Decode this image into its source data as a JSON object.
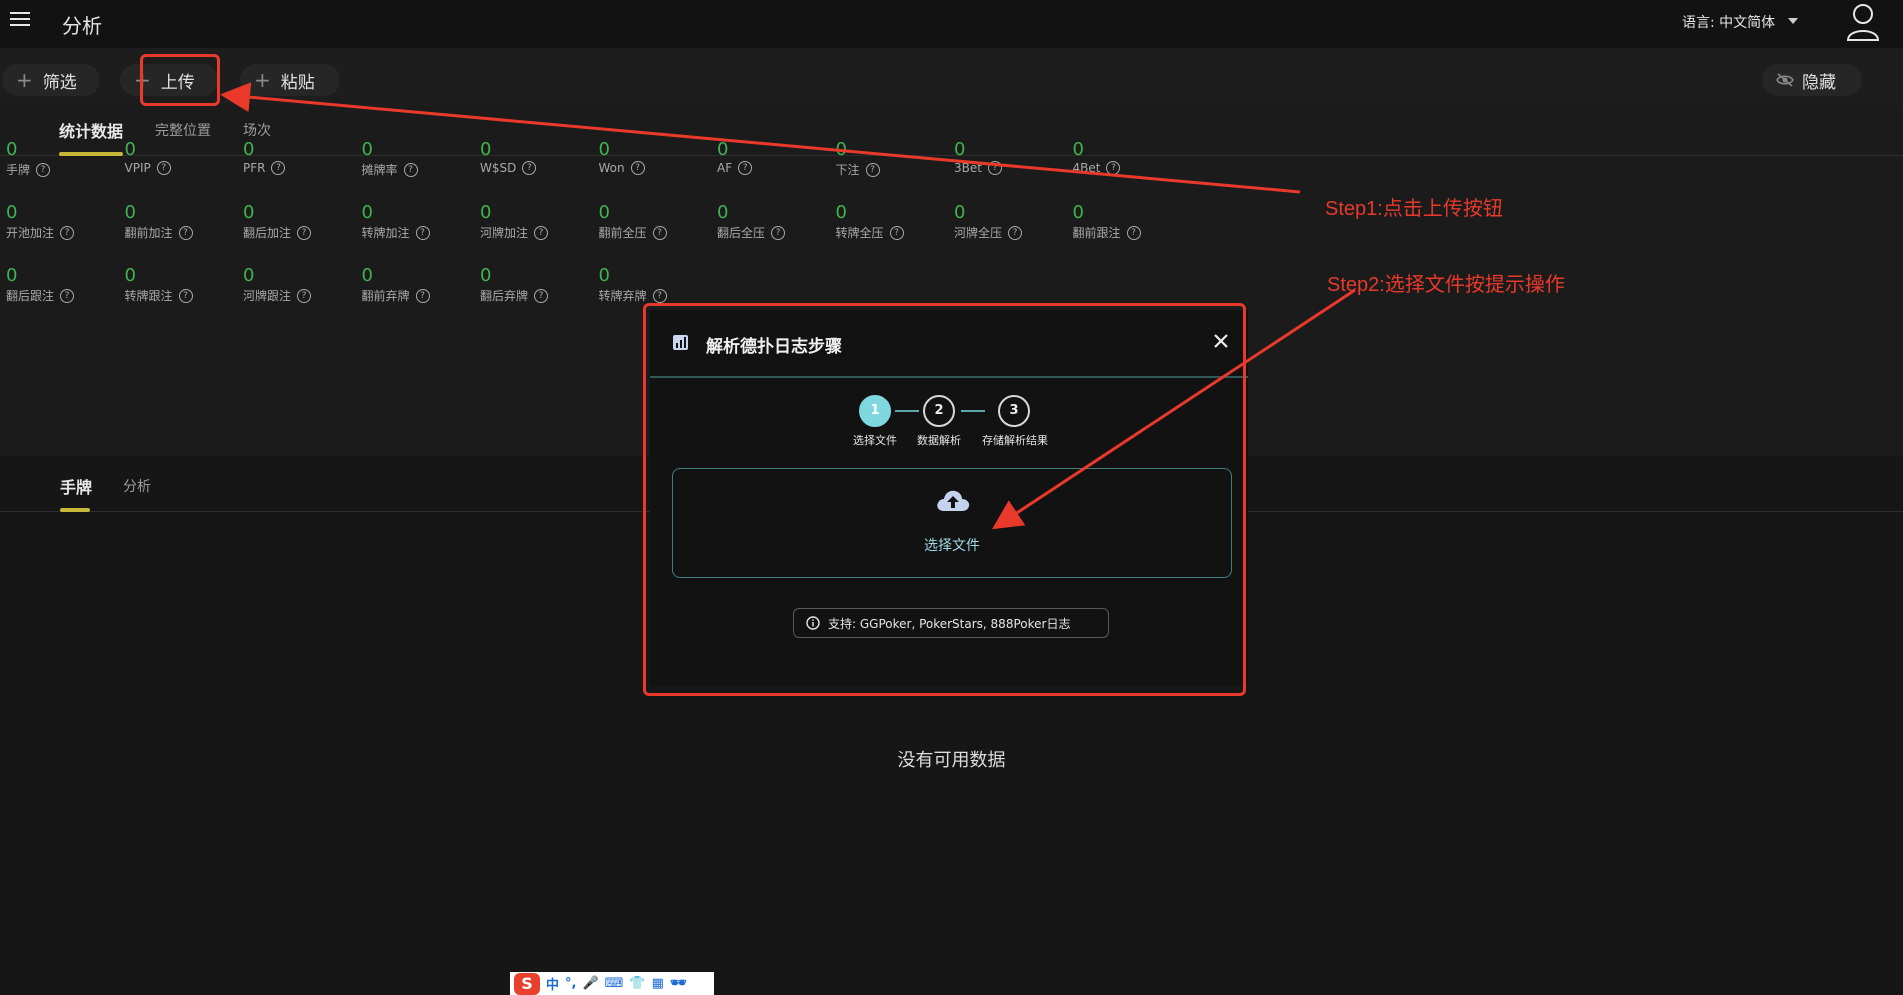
{
  "header": {
    "title": "分析",
    "language_label": "语言: 中文简体"
  },
  "toolbar": {
    "filter_label": "筛选",
    "upload_label": "上传",
    "paste_label": "粘贴",
    "hide_label": "隐藏"
  },
  "stats_tabs": [
    "统计数据",
    "完整位置",
    "场次"
  ],
  "stats": [
    {
      "value": "0",
      "label": "手牌"
    },
    {
      "value": "0",
      "label": "VPIP"
    },
    {
      "value": "0",
      "label": "PFR"
    },
    {
      "value": "0",
      "label": "摊牌率"
    },
    {
      "value": "0",
      "label": "W$SD"
    },
    {
      "value": "0",
      "label": "Won"
    },
    {
      "value": "0",
      "label": "AF"
    },
    {
      "value": "0",
      "label": "下注"
    },
    {
      "value": "0",
      "label": "3Bet"
    },
    {
      "value": "0",
      "label": "4Bet"
    },
    {
      "value": "0",
      "label": "开池加注"
    },
    {
      "value": "0",
      "label": "翻前加注"
    },
    {
      "value": "0",
      "label": "翻后加注"
    },
    {
      "value": "0",
      "label": "转牌加注"
    },
    {
      "value": "0",
      "label": "河牌加注"
    },
    {
      "value": "0",
      "label": "翻前全压"
    },
    {
      "value": "0",
      "label": "翻后全压"
    },
    {
      "value": "0",
      "label": "转牌全压"
    },
    {
      "value": "0",
      "label": "河牌全压"
    },
    {
      "value": "0",
      "label": "翻前跟注"
    },
    {
      "value": "0",
      "label": "翻后跟注"
    },
    {
      "value": "0",
      "label": "转牌跟注"
    },
    {
      "value": "0",
      "label": "河牌跟注"
    },
    {
      "value": "0",
      "label": "翻前弃牌"
    },
    {
      "value": "0",
      "label": "翻后弃牌"
    },
    {
      "value": "0",
      "label": "转牌弃牌"
    }
  ],
  "hands_tabs": [
    "手牌",
    "分析"
  ],
  "hands": {
    "empty_text": "没有可用数据"
  },
  "modal": {
    "title": "解析德扑日志步骤",
    "steps": [
      {
        "number": "1",
        "label": "选择文件"
      },
      {
        "number": "2",
        "label": "数据解析"
      },
      {
        "number": "3",
        "label": "存储解析结果"
      }
    ],
    "select_file_label": "选择文件",
    "support_text": "支持: GGPoker, PokerStars, 888Poker日志"
  },
  "annotations": {
    "step1": "Step1:点击上传按钮",
    "step2": "Step2:选择文件按提示操作",
    "color": "#e8392a"
  },
  "ime": {
    "logo": "S",
    "lang": "中",
    "items": [
      "°,",
      "🎤",
      "⌨",
      "👕",
      "▦",
      "🕶"
    ]
  },
  "colors": {
    "stat_value": "#3fb34f",
    "tab_accent": "#c8b83a",
    "modal_accent": "#7fd7e0",
    "annotation_red": "#e8392a"
  }
}
